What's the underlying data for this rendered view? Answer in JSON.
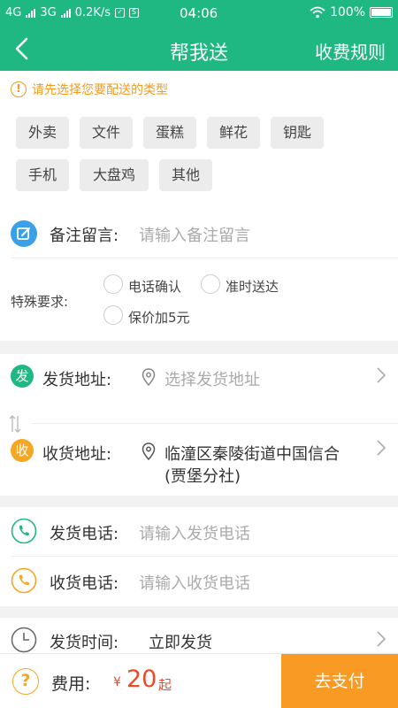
{
  "status_bar": {
    "net1": "4G",
    "net2": "3G",
    "speed": "0.2K/s",
    "sim_badge": "S",
    "time": "04:06",
    "battery": "100%"
  },
  "header": {
    "title": "帮我送",
    "rules_link": "收费规则"
  },
  "type_section": {
    "tip": "请先选择您要配送的类型",
    "tags": [
      "外卖",
      "文件",
      "蛋糕",
      "鲜花",
      "钥匙",
      "手机",
      "大盘鸡",
      "其他"
    ]
  },
  "remark": {
    "label": "备注留言:",
    "placeholder": "请输入备注留言"
  },
  "special": {
    "label": "特殊要求:",
    "options": [
      "电话确认",
      "准时送达",
      "保价加5元"
    ]
  },
  "address": {
    "send_badge": "发",
    "send_label": "发货地址:",
    "send_placeholder": "选择发货地址",
    "recv_badge": "收",
    "recv_label": "收货地址:",
    "recv_line1": "临潼区秦陵街道中国信合",
    "recv_line2": "(贾堡分社)"
  },
  "phone": {
    "send_label": "发货电话:",
    "send_placeholder": "请输入发货电话",
    "recv_label": "收货电话:",
    "recv_placeholder": "请输入收货电话"
  },
  "time_row": {
    "label": "发货时间:",
    "value": "立即发货"
  },
  "footer": {
    "help_icon": "?",
    "fee_label": "费用:",
    "currency": "¥",
    "amount": "20",
    "suffix": "起",
    "pay_button": "去支付"
  },
  "colors": {
    "brand": "#1fb782",
    "accent_orange": "#f89a23",
    "price_red": "#e84b2a"
  }
}
